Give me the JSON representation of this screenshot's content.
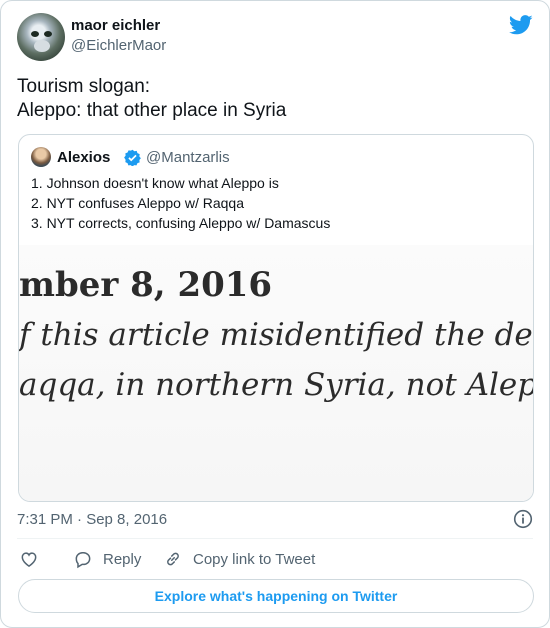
{
  "author": {
    "name": "maor eichler",
    "handle": "@EichlerMaor"
  },
  "tweet": {
    "lines": [
      "Tourism slogan:",
      "Aleppo: that other place in Syria"
    ]
  },
  "quoted": {
    "name": "Alexios",
    "handle": "@Mantzarlis",
    "lines": [
      "1. Johnson doesn't know what Aleppo is",
      "2. NYT confuses Aleppo w/ Raqqa",
      "3. NYT corrects, confusing Aleppo w/ Damascus"
    ],
    "image_text": [
      "mber 8, 2016",
      "f this article misidentified the de facto",
      "aqqa, in northern Syria, not Aleppo"
    ]
  },
  "meta": {
    "timestamp": "7:31 PM · Sep 8, 2016"
  },
  "actions": {
    "reply_label": "Reply",
    "copy_label": "Copy link to Tweet"
  },
  "explore_label": "Explore what's happening on Twitter",
  "icons": {
    "brand": "twitter-bird-icon",
    "verified": "verified-badge-icon",
    "info": "info-icon",
    "like": "heart-icon",
    "reply": "reply-bubble-icon",
    "copy": "link-icon"
  },
  "colors": {
    "accent": "#1d9bf0",
    "secondary_text": "#536471",
    "border": "#cfd9de"
  }
}
